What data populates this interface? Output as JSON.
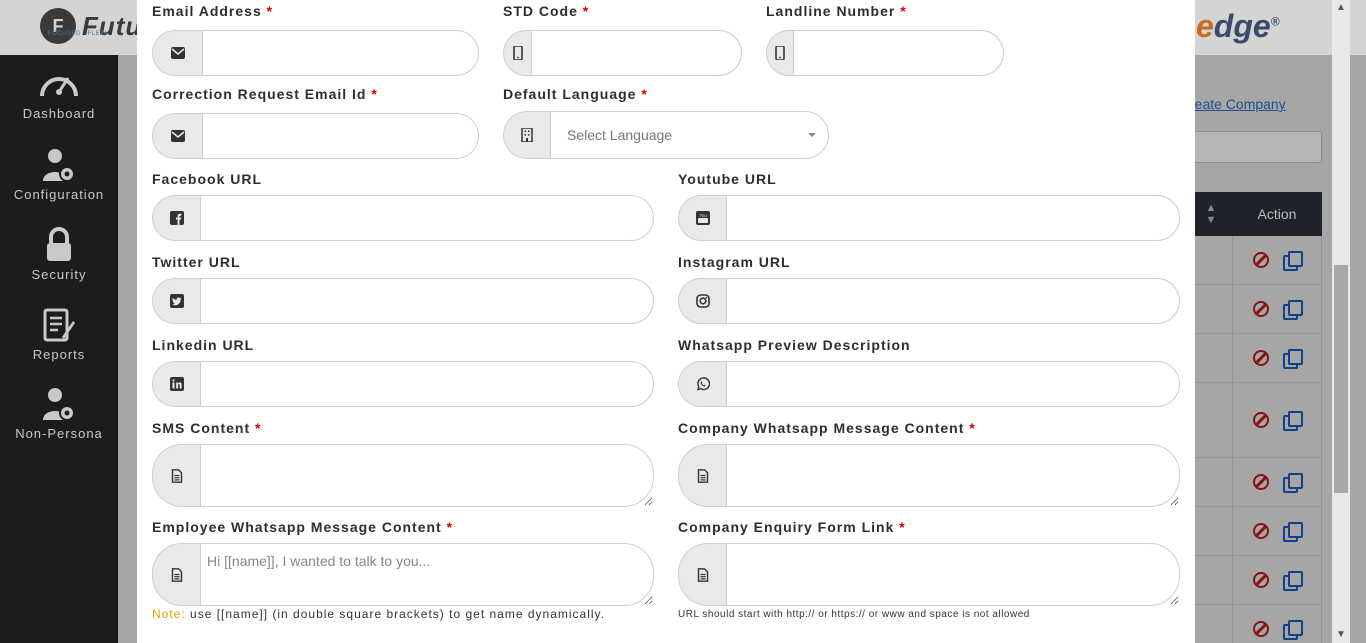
{
  "app": {
    "brand_left": "Futu",
    "brand_left_tagline": "FOCUSED · FLEXI",
    "brand_right_prefix": "e",
    "brand_right": "dge",
    "brand_right_mark": "®"
  },
  "sidebar": {
    "items": [
      {
        "label": "Dashboard",
        "icon": "speedometer-icon"
      },
      {
        "label": "Configuration",
        "icon": "user-gear-icon"
      },
      {
        "label": "Security",
        "icon": "lock-icon"
      },
      {
        "label": "Reports",
        "icon": "report-icon"
      },
      {
        "label": "Non-Persona",
        "icon": "user-gear-icon"
      }
    ]
  },
  "background": {
    "create_link": "reate Company",
    "table_action_header": "Action"
  },
  "form": {
    "email": {
      "label": "Email Address",
      "value": ""
    },
    "std_code": {
      "label": "STD Code",
      "value": ""
    },
    "landline": {
      "label": "Landline Number",
      "value": ""
    },
    "correction_email": {
      "label": "Correction Request Email Id",
      "value": ""
    },
    "default_language": {
      "label": "Default Language",
      "placeholder": "Select Language"
    },
    "facebook": {
      "label": "Facebook URL",
      "value": ""
    },
    "youtube": {
      "label": "Youtube URL",
      "value": ""
    },
    "twitter": {
      "label": "Twitter URL",
      "value": ""
    },
    "instagram": {
      "label": "Instagram URL",
      "value": ""
    },
    "linkedin": {
      "label": "Linkedin URL",
      "value": ""
    },
    "whatsapp_preview": {
      "label": "Whatsapp Preview Description",
      "value": ""
    },
    "sms_content": {
      "label": "SMS Content",
      "value": ""
    },
    "company_whatsapp": {
      "label": "Company Whatsapp Message Content",
      "value": ""
    },
    "employee_whatsapp": {
      "label": "Employee Whatsapp Message Content",
      "placeholder": "Hi [[name]], I wanted to talk to you..."
    },
    "enquiry_link": {
      "label": "Company Enquiry Form Link",
      "value": ""
    },
    "required_mark": "*",
    "note_prefix": "Note:",
    "note_text": " use [[name]] (in double square brackets) to get name dynamically.",
    "url_hint": "URL should start with http:// or https:// or www and space is not allowed"
  },
  "colors": {
    "required": "#d40000",
    "note": "#e5a100"
  }
}
